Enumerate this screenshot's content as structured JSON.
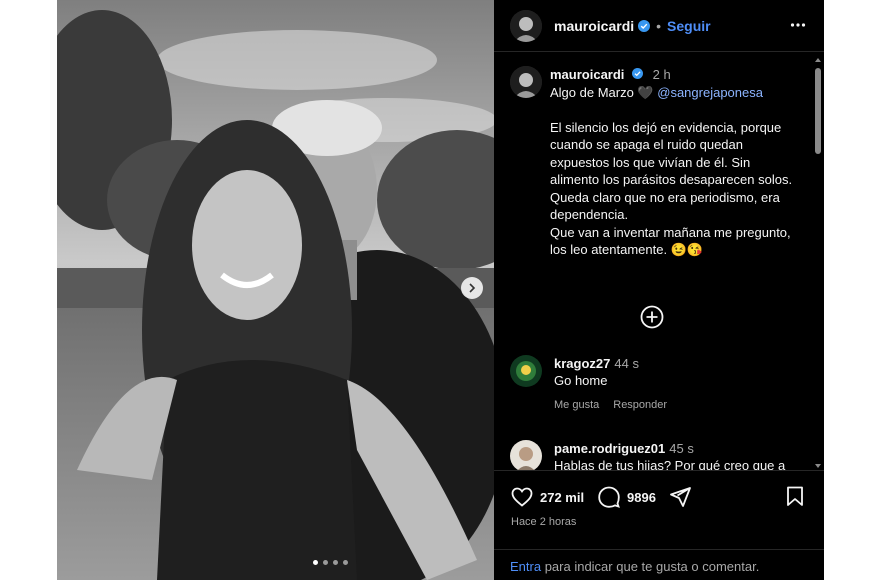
{
  "post": {
    "username": "mauroicardi",
    "separator": "•",
    "follow_label": "Seguir",
    "caption_time": "2 h",
    "caption_intro": "Algo de Marzo 🖤",
    "caption_mention": "@sangrejaponesa",
    "caption_paragraphs": [
      "El silencio los dejó en evidencia, porque cuando se apaga el ruido quedan expuestos los que vivían de él. Sin alimento los parásitos desaparecen solos.",
      "Queda claro que no era periodismo, era dependencia.",
      "Que van a inventar mañana me pregunto, los leo atentamente. 😉😘"
    ],
    "likes": "272 mil",
    "comments_count": "9896",
    "posted_ago": "Hace 2 horas",
    "carousel_total": 4,
    "carousel_index": 1
  },
  "comments": [
    {
      "user": "kragoz27",
      "time": "44 s",
      "text": "Go home",
      "like_label": "Me gusta",
      "reply_label": "Responder"
    },
    {
      "user": "pame.rodriguez01",
      "time": "45 s",
      "text": "Hablas de tus hijas? Por qué creo que a"
    }
  ],
  "comment_prompt": {
    "link": "Entra",
    "text": " para indicar que te gusta o comentar."
  },
  "icons": {
    "verified": "verified-badge-icon",
    "more": "more-options-icon",
    "add_comments": "plus-circle-icon",
    "like": "heart-icon",
    "comment": "comment-bubble-icon",
    "share": "paper-plane-icon",
    "save": "bookmark-icon",
    "next": "chevron-right-icon"
  },
  "colors": {
    "background": "#000000",
    "link": "#4f8ef7",
    "mention": "#8cb4ff",
    "muted": "#a8a8a8"
  }
}
